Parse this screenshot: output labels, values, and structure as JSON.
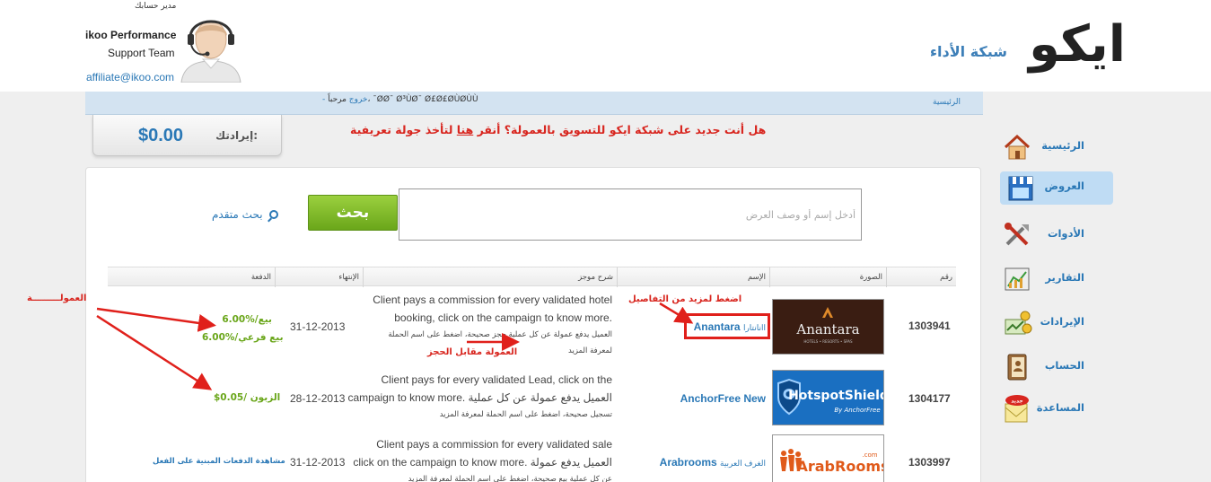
{
  "brand": {
    "logo_text": "ايكو",
    "tagline": "شبكة الأداء"
  },
  "account_manager": {
    "title": "مدير حسابك",
    "name": "ikoo Performance",
    "team": "Support Team",
    "email": "affiliate@ikoo.com"
  },
  "topbar": {
    "home": "الرئيسية",
    "welcome": "مرحباً، ¯ØØ¯ Ø³ÙØ¯ Ø£Ø£ØÙØÙÙ",
    "logout": "- خروج"
  },
  "earnings": {
    "label": "إيرادتك:",
    "value": "$0.00"
  },
  "banner": {
    "text_before": "هل أنت جديد على شبكة ايكو للتسويق بالعمولة؟ أنقر ",
    "link": "هنا",
    "text_after": " لتأخذ جولة تعريفية"
  },
  "search": {
    "placeholder": "أدخل إسم أو وصف العرض",
    "button": "بحث",
    "advanced": "بحث متقدم"
  },
  "table": {
    "headers": {
      "id": "رقم",
      "image": "الصورة",
      "name": "الإسم",
      "description": "شرح موجز",
      "expiry": "الإنتهاء",
      "payout": "الدفعة"
    },
    "rows": [
      {
        "id": "1303941",
        "name": "Anantara",
        "name_ar": "اانانتارا",
        "desc_en_1": "Client pays a commission for every validated hotel",
        "desc_en_2": "booking, click on the campaign to know more.",
        "desc_ar_1": "العميل يدفع عمولة عن كل عملية حجز صحيحة، اضغط على اسم الحملة",
        "desc_ar_2": "لمعرفة المزيد",
        "expiry": "31-12-2013",
        "payout_1": "6.00%/بيع",
        "payout_2": "6.00%/بيع فرعي",
        "logo_text": "Anantara",
        "logo_sub": "HOTELS • RESORTS • SPAS"
      },
      {
        "id": "1304177",
        "name": "AnchorFree New",
        "desc_en_1": "Client pays for every validated Lead, click on the",
        "desc_en_2": "campaign to know more. العميل يدفع عمولة عن كل عملية",
        "desc_ar_1": "تسجيل صحيحة، اضغط على اسم الحملة لمعرفة المزيد",
        "expiry": "28-12-2013",
        "payout_1": "$0.05/ الزبون",
        "logo_text": "HotspotShield",
        "logo_sub": "By AnchorFree"
      },
      {
        "id": "1303997",
        "name": "Arabrooms",
        "name_ar": "الغرف العربية",
        "desc_en_1": "Client pays a commission for every validated sale",
        "desc_en_2": "click on the campaign to know more. العميل يدفع عمولة",
        "desc_ar_1": "عن كل عملية بيع صحيحة، اضغط على اسم الحملة لمعرفة المزيد",
        "expiry": "31-12-2013",
        "payout_link": "مشاهدة الدفعات المبنية على الفعل",
        "logo_text": "ArabRooms",
        "logo_sup": ".com"
      }
    ]
  },
  "annotations": {
    "commission": "العمولـــــــــة",
    "click_details": "اضغط لمزيد من التفاصيل",
    "booking_commission": "العمولة مقابل الحجز"
  },
  "sidebar": {
    "items": [
      {
        "label": "الرئيسية",
        "icon": "home-icon"
      },
      {
        "label": "العروض",
        "icon": "shop-icon"
      },
      {
        "label": "الأدوات",
        "icon": "tools-icon"
      },
      {
        "label": "التقارير",
        "icon": "reports-icon"
      },
      {
        "label": "الإيرادات",
        "icon": "earnings-icon"
      },
      {
        "label": "الحساب",
        "icon": "account-icon"
      },
      {
        "label": "المساعدة",
        "icon": "help-icon",
        "badge": "جديد"
      }
    ]
  },
  "colors": {
    "accent": "#2a78b6",
    "green": "#6aa61a",
    "red": "#d8261f"
  }
}
